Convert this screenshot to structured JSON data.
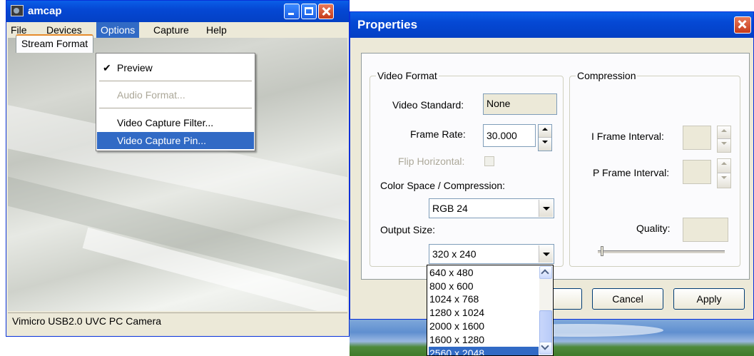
{
  "amcap": {
    "title": "amcap",
    "menu": [
      "File",
      "Devices",
      "Options",
      "Capture",
      "Help"
    ],
    "status": "Vimicro USB2.0 UVC PC Camera"
  },
  "options_menu": {
    "check_mark": "✔",
    "preview": "Preview",
    "audio_format": "Audio Format...",
    "video_capture_filter": "Video Capture Filter...",
    "video_capture_pin": "Video Capture Pin..."
  },
  "properties": {
    "title": "Properties",
    "tab": "Stream Format",
    "video_format": {
      "legend": "Video Format",
      "video_standard_label": "Video Standard:",
      "video_standard_value": "None",
      "frame_rate_label": "Frame Rate:",
      "frame_rate_value": "30.000",
      "flip_horizontal_label": "Flip Horizontal:",
      "color_space_label": "Color Space / Compression:",
      "color_space_value": "RGB 24",
      "output_size_label": "Output Size:",
      "output_size_value": "320 x 240"
    },
    "compression": {
      "legend": "Compression",
      "i_frame_label": "I Frame Interval:",
      "p_frame_label": "P Frame Interval:",
      "quality_label": "Quality:"
    },
    "buttons": {
      "cancel": "Cancel",
      "apply": "Apply"
    }
  },
  "output_size_options": [
    "640 x 480",
    "800 x 600",
    "1024 x 768",
    "1280 x 1024",
    "2000 x 1600",
    "1600 x 1280",
    "2560 x 2048"
  ]
}
